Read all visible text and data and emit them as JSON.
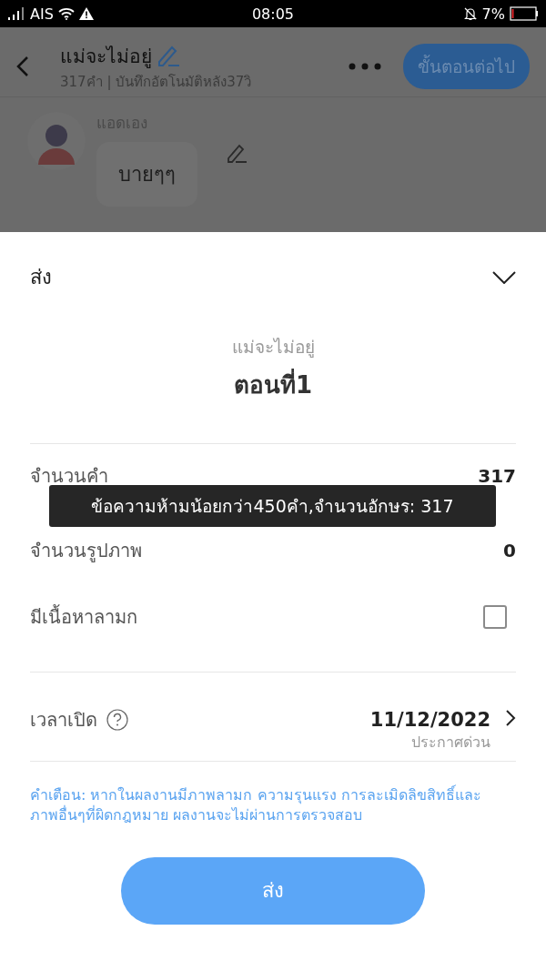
{
  "status_bar": {
    "carrier": "AIS",
    "time": "08:05",
    "battery": "7%"
  },
  "header": {
    "title": "แม่จะไม่อยู่",
    "subtitle": "317คำ | บันทึกอัตโนมัติหลัง37วิ",
    "next_button": "ขั้นตอนต่อไป"
  },
  "chat": {
    "author": "แอดเอง",
    "message": "บายๆๆ"
  },
  "sheet": {
    "title": "ส่ง",
    "book_title": "แม่จะไม่อยู่",
    "chapter": "ตอนที่1",
    "stats": [
      {
        "label": "จำนวนคำ",
        "value": "317"
      },
      {
        "label": "จำนวนรูปภาพ",
        "value": "0"
      }
    ],
    "mature": {
      "label": "มีเนื้อหาลามก",
      "checked": false
    },
    "publish": {
      "label": "เวลาเปิด",
      "date": "11/12/2022",
      "note": "ประกาศด่วน"
    },
    "warning": "คำเตือน: หากในผลงานมีภาพลามก ความรุนแรง การละเมิดลิขสิทธิ์และภาพอื่นๆที่ผิดกฎหมาย ผลงานจะไม่ผ่านการตรวจสอบ",
    "submit_button": "ส่ง"
  },
  "toast": "ข้อความห้ามน้อยกว่า450คำ,จำนวนอักษร: 317"
}
